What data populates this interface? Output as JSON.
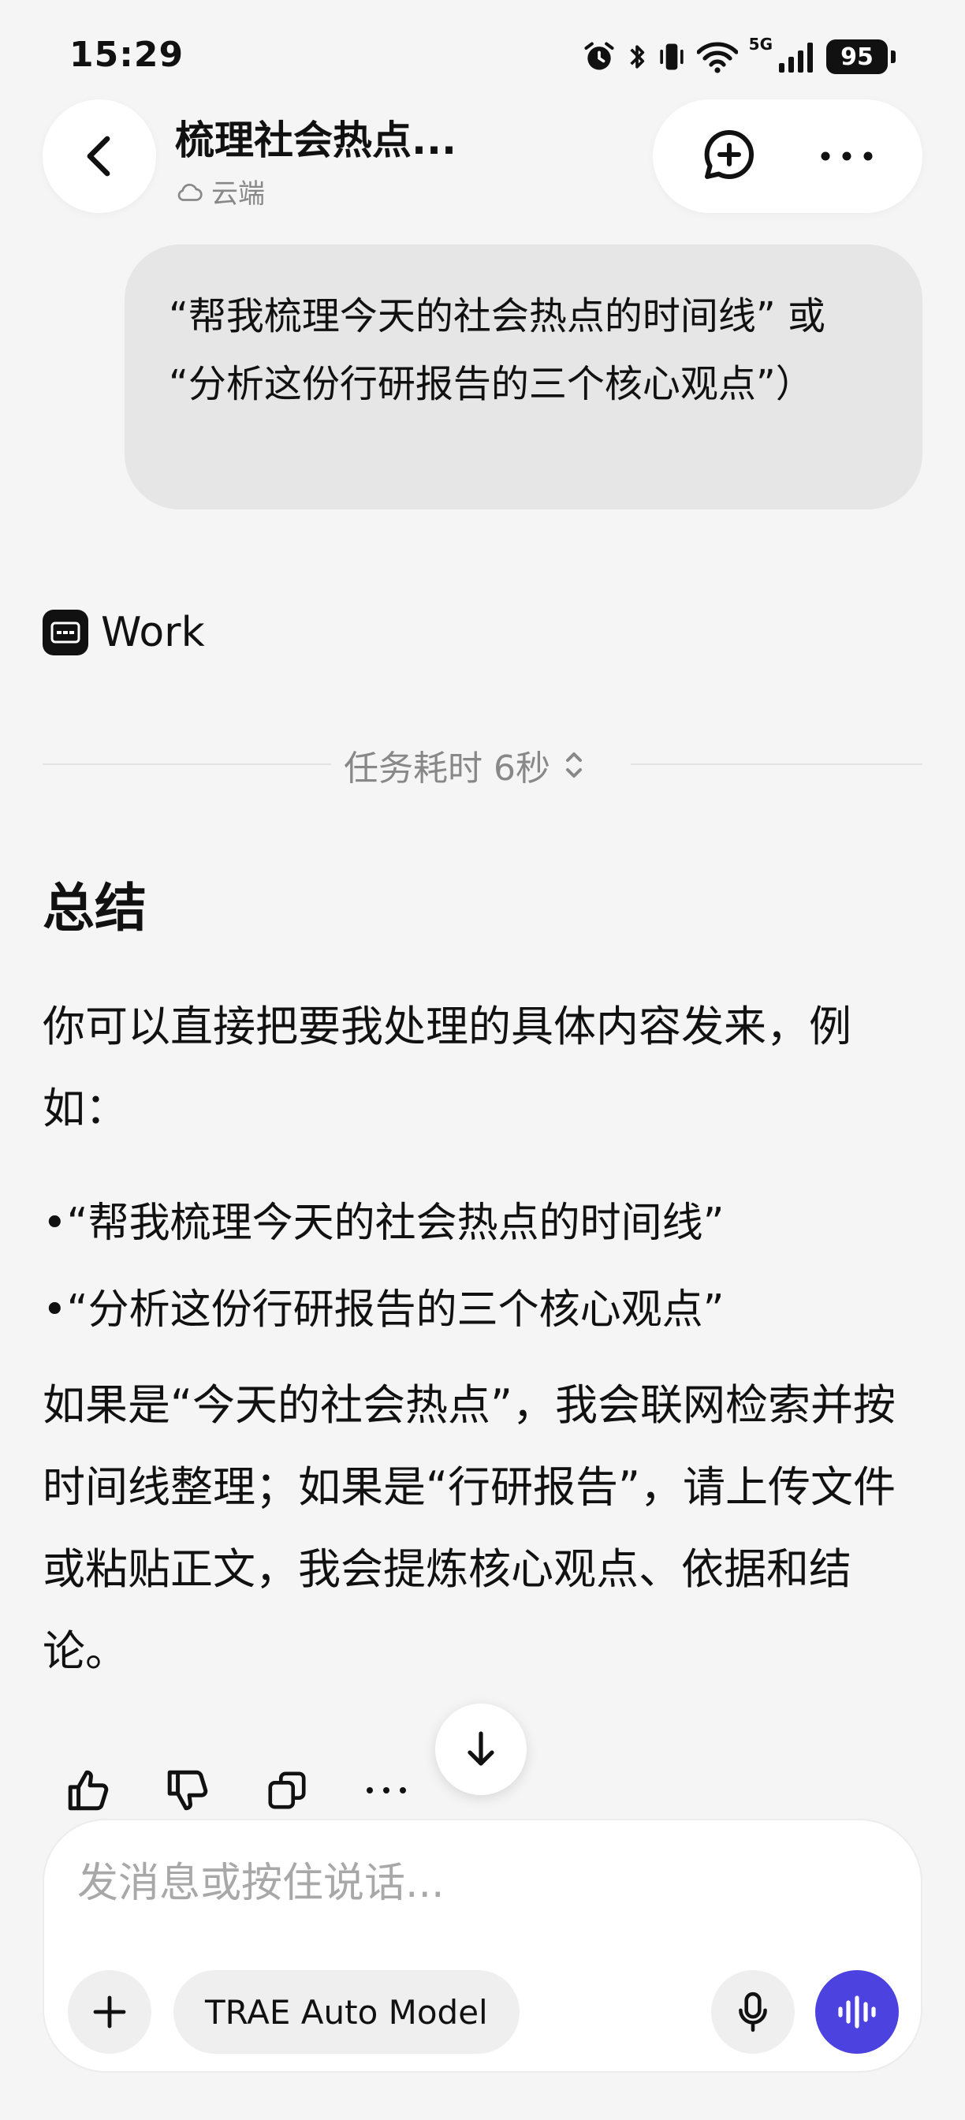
{
  "status_bar": {
    "time": "15:29",
    "network": "5G",
    "battery": "95",
    "icons": [
      "alarm-icon",
      "bluetooth-icon",
      "vibrate-icon",
      "wifi-icon",
      "signal-icon",
      "battery-icon"
    ]
  },
  "header": {
    "title": "梳理社会热点...",
    "subtitle": "云端",
    "icons": [
      "back-icon",
      "cloud-icon",
      "new-chat-icon",
      "more-icon"
    ]
  },
  "conversation": {
    "user_message": "“帮我梳理今天的社会热点的时间线” 或 “分析这份行研报告的三个核心观点”）",
    "agent_name": "Work",
    "task_duration": "任务耗时 6秒",
    "summary": {
      "heading": "总结",
      "intro": "你可以直接把要我处理的具体内容发来，例如：",
      "bullets": [
        "•“帮我梳理今天的社会热点的时间线”",
        "•“分析这份行研报告的三个核心观点”"
      ],
      "detail": "如果是“今天的社会热点”，我会联网检索并按时间线整理；如果是“行研报告”，请上传文件或粘贴正文，我会提炼核心观点、依据和结论。"
    },
    "feedback_icons": [
      "thumbs-up-icon",
      "thumbs-down-icon",
      "copy-icon",
      "more-icon"
    ]
  },
  "composer": {
    "placeholder": "发消息或按住说话...",
    "model_label": "TRAE Auto Model",
    "icons": [
      "plus-icon",
      "microphone-icon",
      "voice-wave-icon"
    ],
    "accent_color": "#4b42e0"
  }
}
